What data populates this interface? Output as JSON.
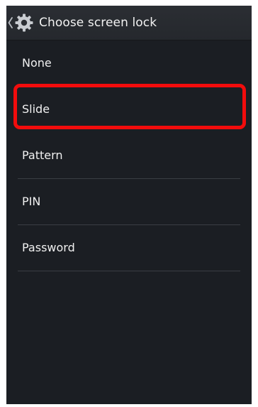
{
  "action_bar": {
    "title": "Choose screen lock",
    "back_icon": "chevron-left-icon",
    "app_icon": "gear-icon"
  },
  "lock_options": [
    {
      "label": "None"
    },
    {
      "label": "Slide"
    },
    {
      "label": "Pattern"
    },
    {
      "label": "PIN"
    },
    {
      "label": "Password"
    }
  ],
  "highlighted_option": "Slide",
  "colors": {
    "background": "#1b1e23",
    "action_bar": "#2b2e33",
    "text": "#f0f0f0",
    "highlight": "#f20c0c"
  }
}
